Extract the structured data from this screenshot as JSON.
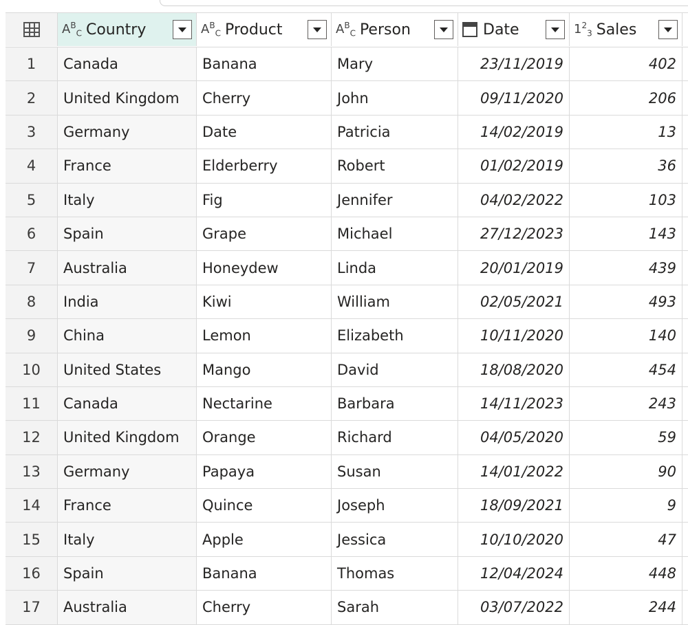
{
  "columns": [
    {
      "type_icon": "ABC",
      "name": "Country"
    },
    {
      "type_icon": "ABC",
      "name": "Product"
    },
    {
      "type_icon": "ABC",
      "name": "Person"
    },
    {
      "type_icon": "calendar",
      "name": "Date"
    },
    {
      "type_icon": "123",
      "name": "Sales"
    }
  ],
  "rows": [
    {
      "idx": "1",
      "country": "Canada",
      "product": "Banana",
      "person": "Mary",
      "date": "23/11/2019",
      "sales": "402"
    },
    {
      "idx": "2",
      "country": "United Kingdom",
      "product": "Cherry",
      "person": "John",
      "date": "09/11/2020",
      "sales": "206"
    },
    {
      "idx": "3",
      "country": "Germany",
      "product": "Date",
      "person": "Patricia",
      "date": "14/02/2019",
      "sales": "13"
    },
    {
      "idx": "4",
      "country": "France",
      "product": "Elderberry",
      "person": "Robert",
      "date": "01/02/2019",
      "sales": "36"
    },
    {
      "idx": "5",
      "country": "Italy",
      "product": "Fig",
      "person": "Jennifer",
      "date": "04/02/2022",
      "sales": "103"
    },
    {
      "idx": "6",
      "country": "Spain",
      "product": "Grape",
      "person": "Michael",
      "date": "27/12/2023",
      "sales": "143"
    },
    {
      "idx": "7",
      "country": "Australia",
      "product": "Honeydew",
      "person": "Linda",
      "date": "20/01/2019",
      "sales": "439"
    },
    {
      "idx": "8",
      "country": "India",
      "product": "Kiwi",
      "person": "William",
      "date": "02/05/2021",
      "sales": "493"
    },
    {
      "idx": "9",
      "country": "China",
      "product": "Lemon",
      "person": "Elizabeth",
      "date": "10/11/2020",
      "sales": "140"
    },
    {
      "idx": "10",
      "country": "United States",
      "product": "Mango",
      "person": "David",
      "date": "18/08/2020",
      "sales": "454"
    },
    {
      "idx": "11",
      "country": "Canada",
      "product": "Nectarine",
      "person": "Barbara",
      "date": "14/11/2023",
      "sales": "243"
    },
    {
      "idx": "12",
      "country": "United Kingdom",
      "product": "Orange",
      "person": "Richard",
      "date": "04/05/2020",
      "sales": "59"
    },
    {
      "idx": "13",
      "country": "Germany",
      "product": "Papaya",
      "person": "Susan",
      "date": "14/01/2022",
      "sales": "90"
    },
    {
      "idx": "14",
      "country": "France",
      "product": "Quince",
      "person": "Joseph",
      "date": "18/09/2021",
      "sales": "9"
    },
    {
      "idx": "15",
      "country": "Italy",
      "product": "Apple",
      "person": "Jessica",
      "date": "10/10/2020",
      "sales": "47"
    },
    {
      "idx": "16",
      "country": "Spain",
      "product": "Banana",
      "person": "Thomas",
      "date": "12/04/2024",
      "sales": "448"
    },
    {
      "idx": "17",
      "country": "Australia",
      "product": "Cherry",
      "person": "Sarah",
      "date": "03/07/2022",
      "sales": "244"
    }
  ],
  "colors": {
    "selected_header": "#dff2ee",
    "index_column": "#f3f3f3",
    "grid_line": "#dadada"
  }
}
